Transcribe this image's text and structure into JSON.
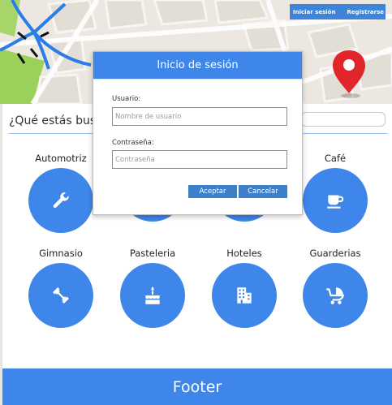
{
  "header": {
    "login_link": "Iniciar sesión",
    "register_link": "Registrarse"
  },
  "search": {
    "label": "¿Qué estás bus",
    "value": ""
  },
  "categories": [
    {
      "label": "Automotriz",
      "icon": "wrench-icon"
    },
    {
      "label": "",
      "icon": ""
    },
    {
      "label": "",
      "icon": ""
    },
    {
      "label": "Café",
      "icon": "coffee-cup-icon"
    },
    {
      "label": "Gimnasio",
      "icon": "dumbbell-icon"
    },
    {
      "label": "Pasteleria",
      "icon": "cake-icon"
    },
    {
      "label": "Hoteles",
      "icon": "building-icon"
    },
    {
      "label": "Guarderias",
      "icon": "stroller-icon"
    }
  ],
  "modal": {
    "title": "Inicio de sesión",
    "username_label": "Usuario:",
    "username_placeholder": "Nombre de usuario",
    "password_label": "Contraseña:",
    "password_placeholder": "Contraseña",
    "accept_label": "Aceptar",
    "cancel_label": "Cancelar"
  },
  "footer": {
    "text": "Footer"
  },
  "colors": {
    "primary": "#3e86e9",
    "button": "#3e7fc9",
    "auth_bar": "#3e85d9",
    "pin": "#e0262a"
  }
}
